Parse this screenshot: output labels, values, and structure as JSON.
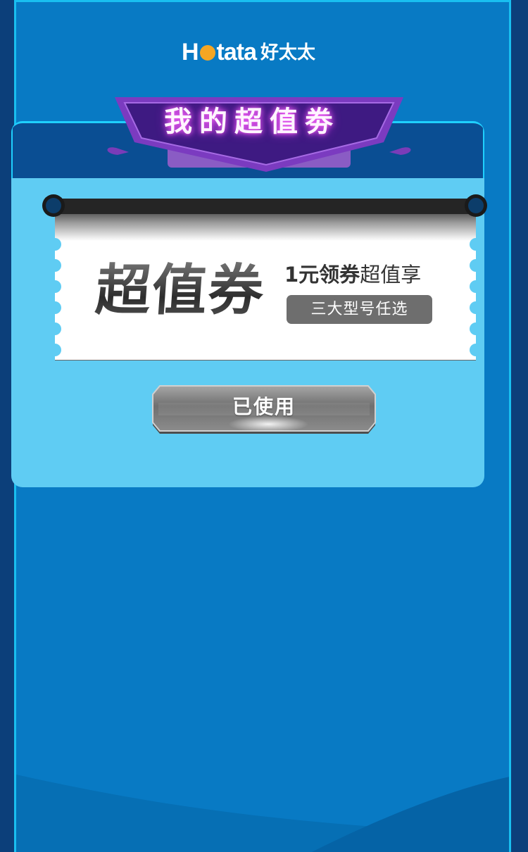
{
  "brand": {
    "logo_text_left": "H",
    "logo_text_right": "tata",
    "logo_cn": "好太太"
  },
  "banner": {
    "title": "我的超值劵"
  },
  "coupon": {
    "big_title": "超值券",
    "promo_bold": "1元领券",
    "promo_light": "超值享",
    "tag": "三大型号任选"
  },
  "action": {
    "button_label": "已使用"
  },
  "colors": {
    "page_bg": "#087ac4",
    "card_bg": "#5fccf3",
    "header_bg": "#0a4e93",
    "banner_purple": "#6a2fa8",
    "logo_dot": "#f5a623"
  }
}
